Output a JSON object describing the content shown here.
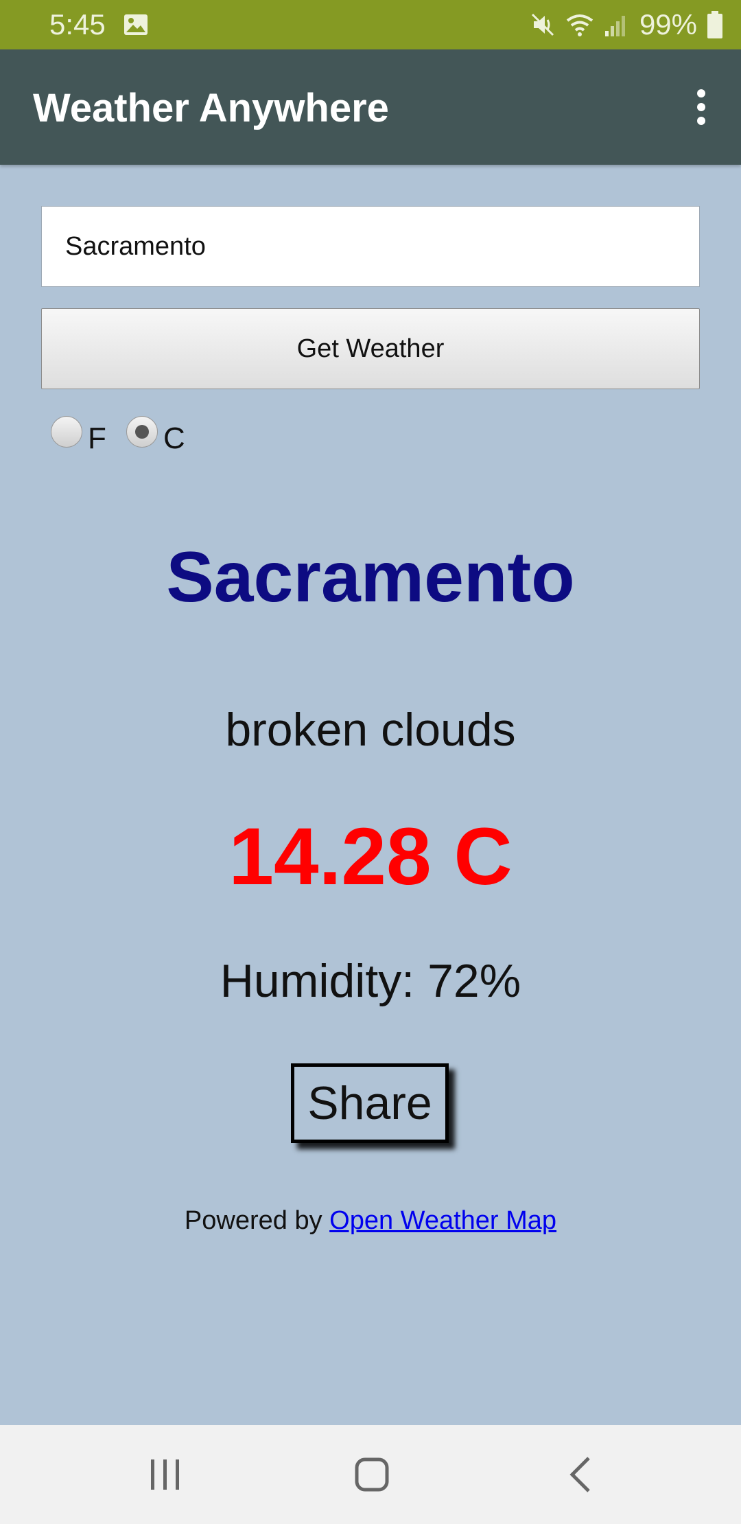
{
  "status_bar": {
    "time": "5:45",
    "battery": "99%",
    "icons": [
      "photo-icon",
      "mute-icon",
      "wifi-icon",
      "signal-icon",
      "battery-icon"
    ]
  },
  "app_bar": {
    "title": "Weather Anywhere",
    "menu_icon": "overflow-menu-icon"
  },
  "search": {
    "value": "Sacramento",
    "button_label": "Get Weather"
  },
  "units": {
    "options": [
      {
        "label": "F",
        "checked": false
      },
      {
        "label": "C",
        "checked": true
      }
    ]
  },
  "weather": {
    "city": "Sacramento",
    "description": "broken clouds",
    "temperature": "14.28 C",
    "humidity": "Humidity: 72%"
  },
  "share_label": "Share",
  "footer": {
    "prefix": "Powered by",
    "link_text": "Open Weather Map"
  },
  "nav_bar": {
    "icons": [
      "recent-apps-icon",
      "home-icon",
      "back-icon"
    ]
  },
  "colors": {
    "status_bar": "#859a23",
    "app_bar": "#435657",
    "background": "#b0c3d6",
    "city": "#0d0b82",
    "temperature": "#ff0000",
    "link": "#0000ee"
  }
}
